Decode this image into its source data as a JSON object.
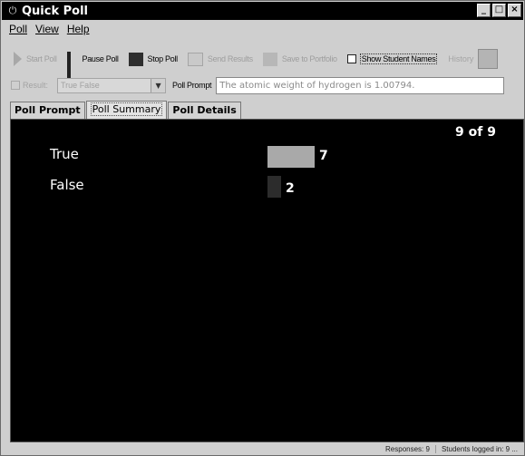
{
  "window": {
    "title": "Quick Poll",
    "icon": "power-icon"
  },
  "menu": [
    {
      "label": "Poll"
    },
    {
      "label": "View"
    },
    {
      "label": "Help"
    }
  ],
  "toolbar": {
    "start_poll": "Start Poll",
    "pause_poll": "Pause Poll",
    "stop_poll": "Stop Poll",
    "send_results": "Send Results",
    "save_to_portfolio": "Save to Portfolio",
    "show_student_names": "Show Student Names",
    "history": "History"
  },
  "row2": {
    "result_label": "Result:",
    "poll_type": "True False",
    "poll_prompt_label": "Poll Prompt",
    "poll_prompt_value": "The atomic weight of hydrogen is 1.00794."
  },
  "tabs": [
    {
      "label": "Poll Prompt"
    },
    {
      "label": "Poll Summary"
    },
    {
      "label": "Poll Details"
    }
  ],
  "summary": {
    "count": "9 of 9",
    "options": [
      {
        "label": "True",
        "value": 7,
        "display": "7",
        "color": "#a9a9a9"
      },
      {
        "label": "False",
        "value": 2,
        "display": "2",
        "color": "#2c2c2c"
      }
    ]
  },
  "status": {
    "responses": "Responses: 9",
    "students_logged": "Students logged in: 9 ..."
  }
}
